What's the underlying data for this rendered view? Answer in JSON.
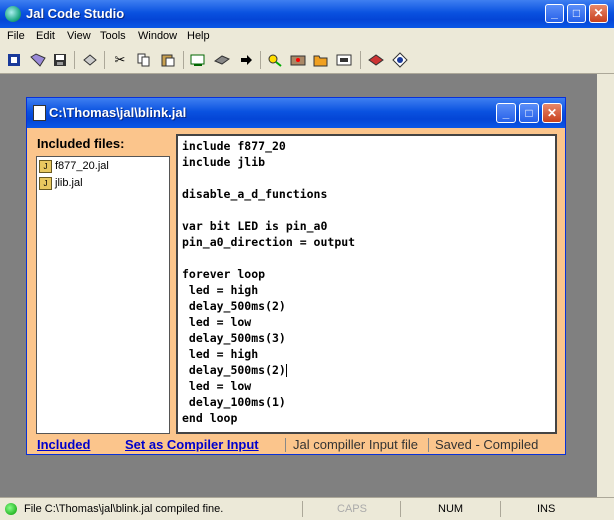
{
  "app": {
    "title": "Jal Code Studio",
    "caption_buttons": {
      "minimize": "_",
      "maximize": "□",
      "close": "✕"
    }
  },
  "menu": [
    "File",
    "Edit",
    "View",
    "Tools",
    "Window",
    "Help"
  ],
  "toolbar": {
    "icons": [
      "open-project-icon",
      "open-file-icon",
      "save-icon",
      "print-icon",
      "cut-icon",
      "copy-icon",
      "paste-icon",
      "compile-icon",
      "program-icon",
      "run-arrow-icon",
      "find-icon",
      "settings-icon",
      "folder-icon",
      "device-icon",
      "help-book-icon",
      "info-icon"
    ]
  },
  "child_window": {
    "title": "C:\\Thomas\\jal\\blink.jal",
    "included_label": "Included files:",
    "files": [
      "f877_20.jal",
      "jlib.jal"
    ],
    "code_lines": [
      "include f877_20",
      "include jlib",
      "",
      "disable_a_d_functions",
      "",
      "var bit LED is pin_a0",
      "pin_a0_direction = output",
      "",
      "forever loop",
      " led = high",
      " delay_500ms(2)",
      " led = low",
      " delay_500ms(3)",
      " led = high",
      " delay_500ms(2)",
      " led = low",
      " delay_100ms(1)",
      "end loop"
    ],
    "status": {
      "included_link": "Included",
      "set_compiler_link": "Set as Compiler Input",
      "compiler_input": "Jal compiller Input file",
      "saved_state": "Saved - Compiled"
    }
  },
  "statusbar": {
    "message": "File C:\\Thomas\\jal\\blink.jal compiled fine.",
    "caps": "CAPS",
    "num": "NUM",
    "ins": "INS"
  },
  "colors": {
    "titlebar": "#0a52e0",
    "child_bg": "#fbc58c",
    "link": "#0000cc"
  }
}
